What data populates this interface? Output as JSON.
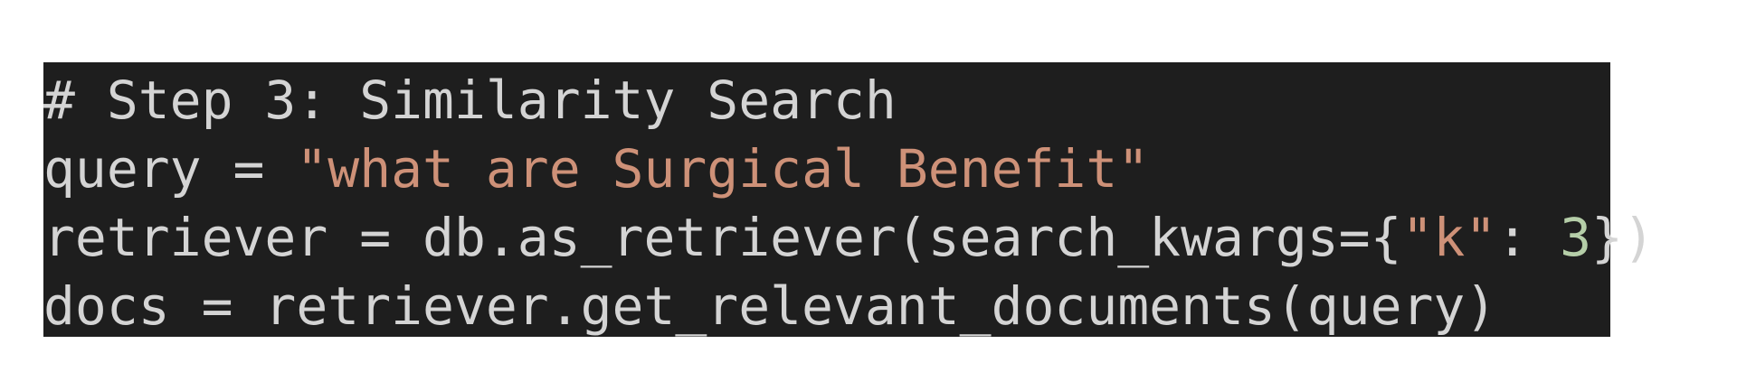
{
  "code": {
    "line1": {
      "comment": "# Step 3: Similarity Search"
    },
    "line2": {
      "prefix": "query = ",
      "string": "\"what are Surgical Benefit\""
    },
    "line3": {
      "prefix": "retriever = db.as_retriever(search_kwargs={",
      "key": "\"k\"",
      "colon": ": ",
      "number": "3",
      "suffix": "})"
    },
    "line4": {
      "text": "docs = retriever.get_relevant_documents(query)"
    }
  },
  "colors": {
    "background": "#1e1e1e",
    "text": "#d4d4d4",
    "string": "#ce9178",
    "number": "#b5cea8"
  }
}
